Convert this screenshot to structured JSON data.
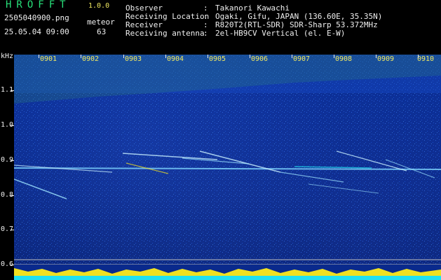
{
  "header": {
    "logo": "HROFFT",
    "version": "1.0.0",
    "filename": "2505040900.png",
    "meteor_label": "meteor",
    "datetime": "25.05.04 09:00",
    "meteor_count": "63",
    "observer_label": "Observer",
    "observer_value": "Takanori Kawachi",
    "location_label": "Receiving Location",
    "location_value": "Ogaki, Gifu, JAPAN (136.60E, 35.35N)",
    "receiver_label": "Receiver",
    "receiver_value": "R820T2(RTL-SDR) SDR-Sharp 53.372MHz",
    "antenna_label": "Receiving antenna",
    "antenna_value": "2el-HB9CV Vertical (el. E-W)",
    "colon": ":"
  },
  "axis": {
    "unit": "kHz",
    "y_ticks": [
      "1.1",
      "1.0",
      "0.9",
      "0.8",
      "0.7",
      "0.6"
    ],
    "x_ticks": [
      "0901",
      "0902",
      "0903",
      "0904",
      "0905",
      "0906",
      "0907",
      "0908",
      "0909",
      "0910"
    ]
  },
  "colors": {
    "background": "#0a2a8c",
    "carrier": "#7fd7ff",
    "trail": "#c8f0ff",
    "yellow": "#f0e020",
    "cyan": "#20e0f0"
  }
}
